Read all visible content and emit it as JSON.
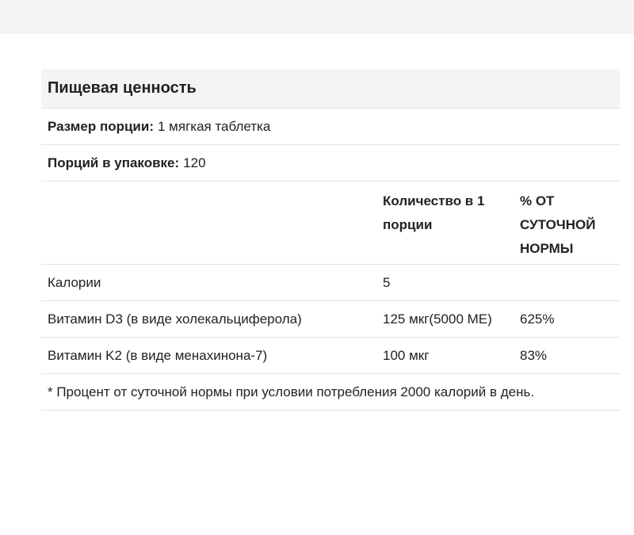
{
  "nutrition": {
    "title": "Пищевая ценность",
    "serving_size_label": "Размер порции:",
    "serving_size_value": "1 мягкая таблетка",
    "servings_label": "Порций в упаковке:",
    "servings_value": "120",
    "columns": {
      "amount": "Количество в 1 порции",
      "daily_value": "% ОТ СУТОЧНОЙ НОРМЫ"
    },
    "rows": [
      {
        "name": "Калории",
        "amount": "5",
        "dv": ""
      },
      {
        "name": "Витамин D3 (в виде холекальциферола)",
        "amount": "125 мкг(5000 МЕ)",
        "dv": "625%"
      },
      {
        "name": "Витамин K2 (в виде менахинона-7)",
        "amount": "100 мкг",
        "dv": "83%"
      }
    ],
    "footnote": "* Процент от суточной нормы при условии потребления 2000 калорий в день."
  }
}
